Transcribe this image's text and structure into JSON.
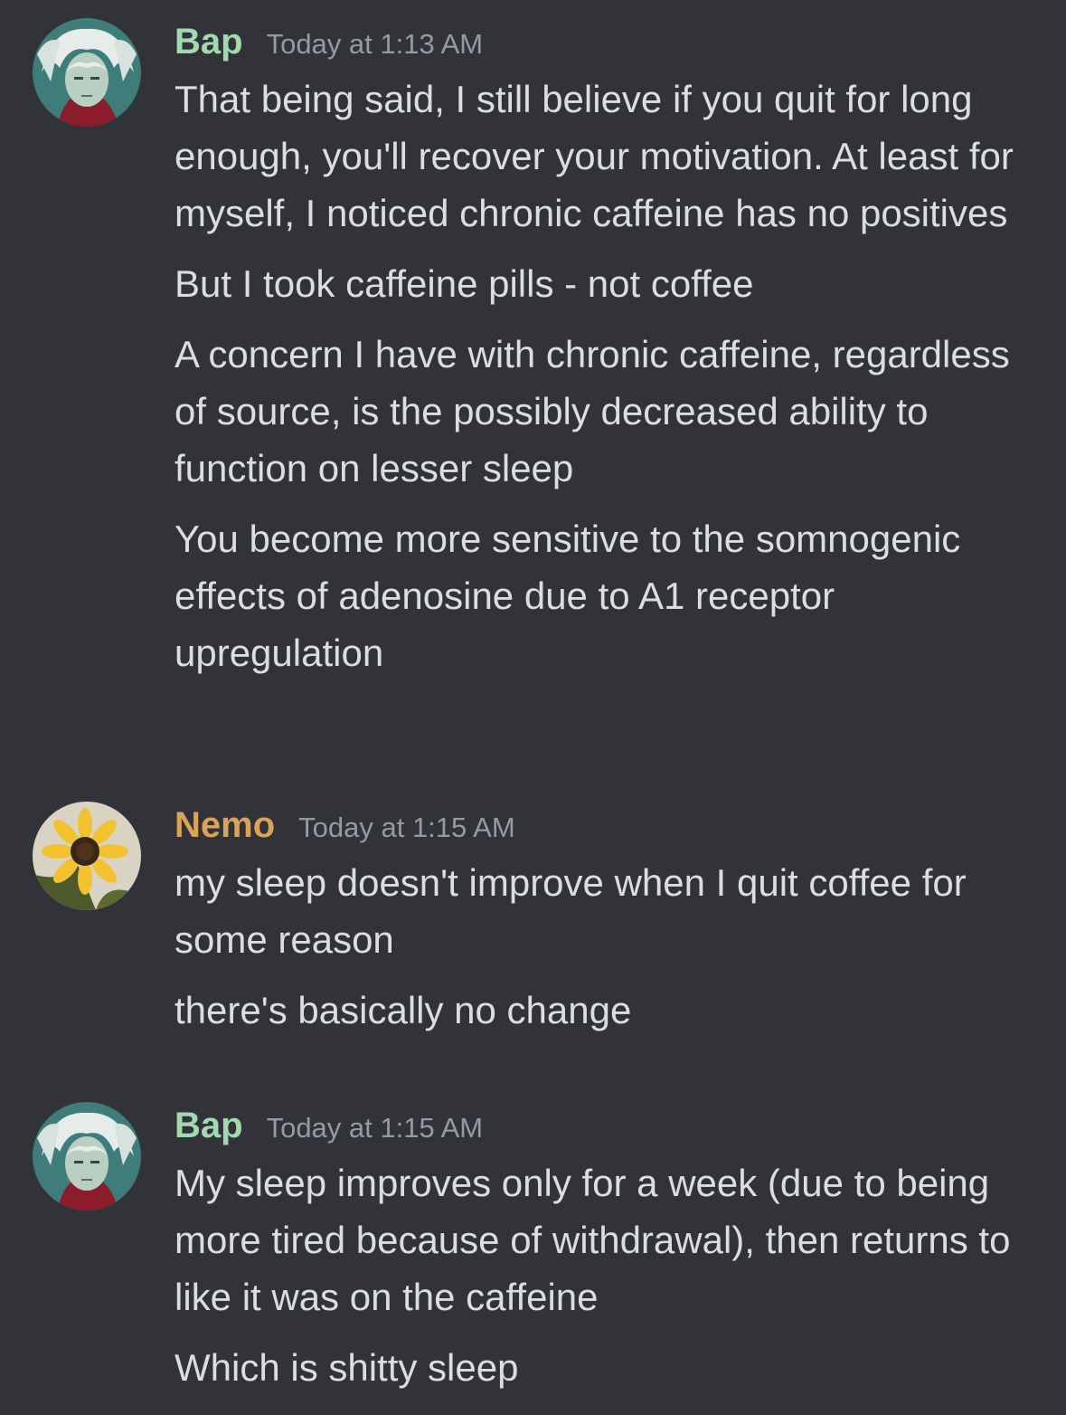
{
  "colors": {
    "background": "#313338",
    "text": "#dbdee1",
    "timestamp": "#949ba4"
  },
  "groups": [
    {
      "author": "Bap",
      "author_color": "#a3d9b1",
      "avatar_icon": "anime-character-avatar",
      "timestamp": "Today at 1:13 AM",
      "messages": [
        "That being said, I still believe if you quit for long enough, you'll recover your motivation. At least for myself, I noticed chronic caffeine has no positives",
        "But I took caffeine pills - not coffee",
        "A concern I have with chronic caffeine, regardless of source, is the possibly decreased ability to function on lesser sleep",
        "You become more sensitive to the somnogenic effects of adenosine due to A1 receptor upregulation"
      ]
    },
    {
      "author": "Nemo",
      "author_color": "#d9a35b",
      "avatar_icon": "sunflower-avatar",
      "timestamp": "Today at 1:15 AM",
      "messages": [
        "my sleep doesn't improve when I quit coffee for some reason",
        "there's basically no change"
      ]
    },
    {
      "author": "Bap",
      "author_color": "#a3d9b1",
      "avatar_icon": "anime-character-avatar",
      "timestamp": "Today at 1:15 AM",
      "messages": [
        "My sleep improves only for a week (due to being more tired because of withdrawal), then returns to like it was on the caffeine",
        "Which is shitty sleep"
      ]
    }
  ]
}
